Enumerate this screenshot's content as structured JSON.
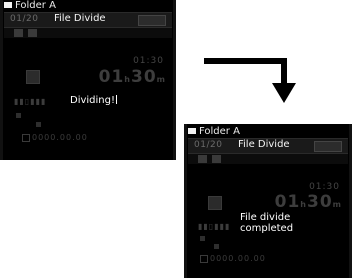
{
  "screen_before": {
    "folder_label": "Folder A",
    "counter": "01/20",
    "title": "File Divide",
    "mid_time": "01:30",
    "big_time": "01",
    "big_time_unit_h": "h",
    "big_time_min": "30",
    "big_time_unit_m": "m",
    "status": "Dividing",
    "status_suffix": "!",
    "date": "0000.00.00"
  },
  "screen_after": {
    "folder_label": "Folder A",
    "counter": "01/20",
    "title": "File Divide",
    "mid_time": "01:30",
    "big_time": "01",
    "big_time_unit_h": "h",
    "big_time_min": "30",
    "big_time_unit_m": "m",
    "status_line1": "File divide",
    "status_line2": "completed",
    "date": "0000.00.00"
  },
  "colors": {
    "screen_bg": "#000000",
    "text_white": "#ffffff",
    "dim_grey": "#3d3d3d",
    "page_bg": "#ffffff",
    "arrow": "#000000"
  },
  "icons": {
    "folder": "folder-icon",
    "arrow": "arrow-down-right-icon"
  }
}
